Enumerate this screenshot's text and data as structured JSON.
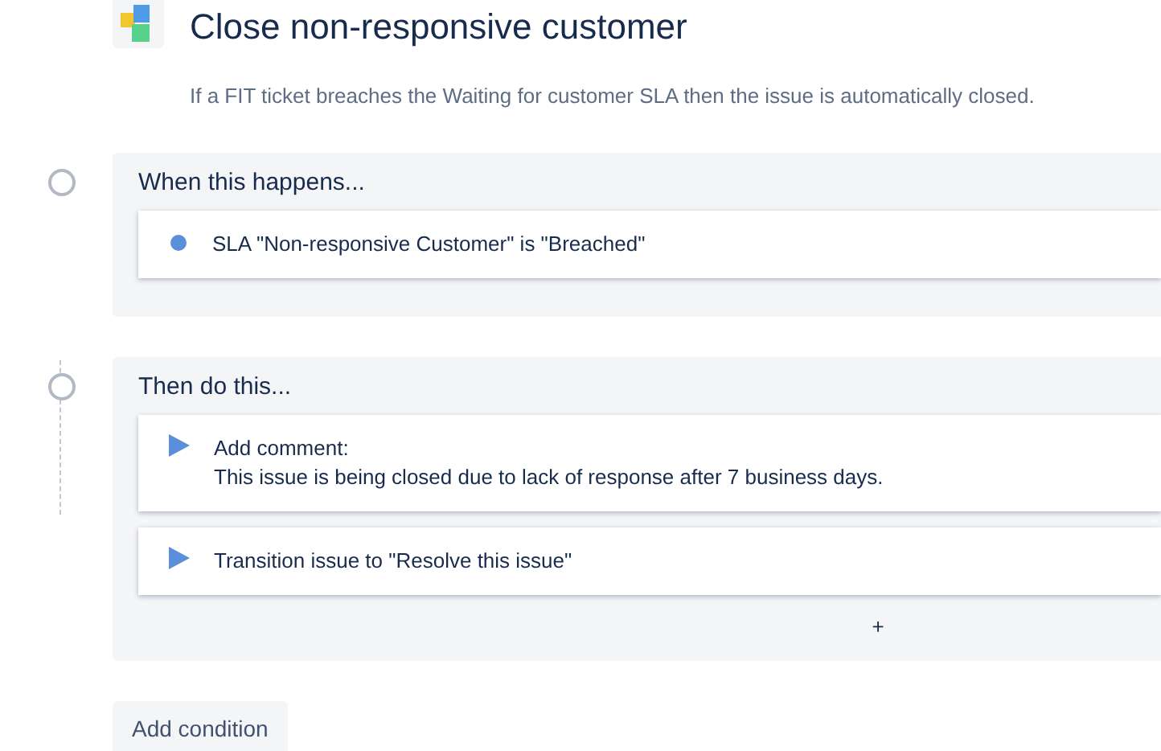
{
  "rule": {
    "title": "Close non-responsive customer",
    "description": "If a FIT ticket breaches the Waiting for customer SLA then the issue is automatically closed."
  },
  "sections": [
    {
      "heading": "When this happens...",
      "items": [
        {
          "kind": "condition",
          "lines": [
            "SLA \"Non-responsive Customer\" is \"Breached\""
          ]
        }
      ]
    },
    {
      "heading": "Then do this...",
      "items": [
        {
          "kind": "action",
          "lines": [
            "Add comment:",
            "This issue is being closed due to lack of response after 7 business days."
          ]
        },
        {
          "kind": "action",
          "lines": [
            "Transition issue to \"Resolve this issue\""
          ]
        }
      ],
      "add_label": "+"
    }
  ],
  "add_condition": "Add condition"
}
